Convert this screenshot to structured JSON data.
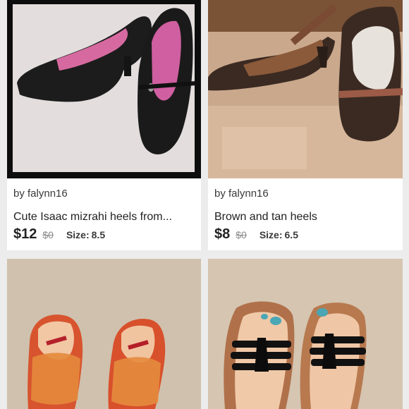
{
  "listings": [
    {
      "seller": "by falynn16",
      "title": "Cute Isaac mizrahi heels from...",
      "price": "$12",
      "original_price": "$0",
      "size_label": "Size:",
      "size": "8.5",
      "photo": "black-pumps-photo"
    },
    {
      "seller": "by falynn16",
      "title": "Brown and tan heels",
      "price": "$8",
      "original_price": "$0",
      "size_label": "Size:",
      "size": "6.5",
      "photo": "brown-tan-heels-photo"
    },
    {
      "photo": "plaid-flats-photo"
    },
    {
      "photo": "black-strap-sandals-photo"
    }
  ],
  "colors": {
    "background": "#ececec",
    "card": "#ffffff",
    "text": "#222222",
    "muted": "#8a8a8a"
  }
}
